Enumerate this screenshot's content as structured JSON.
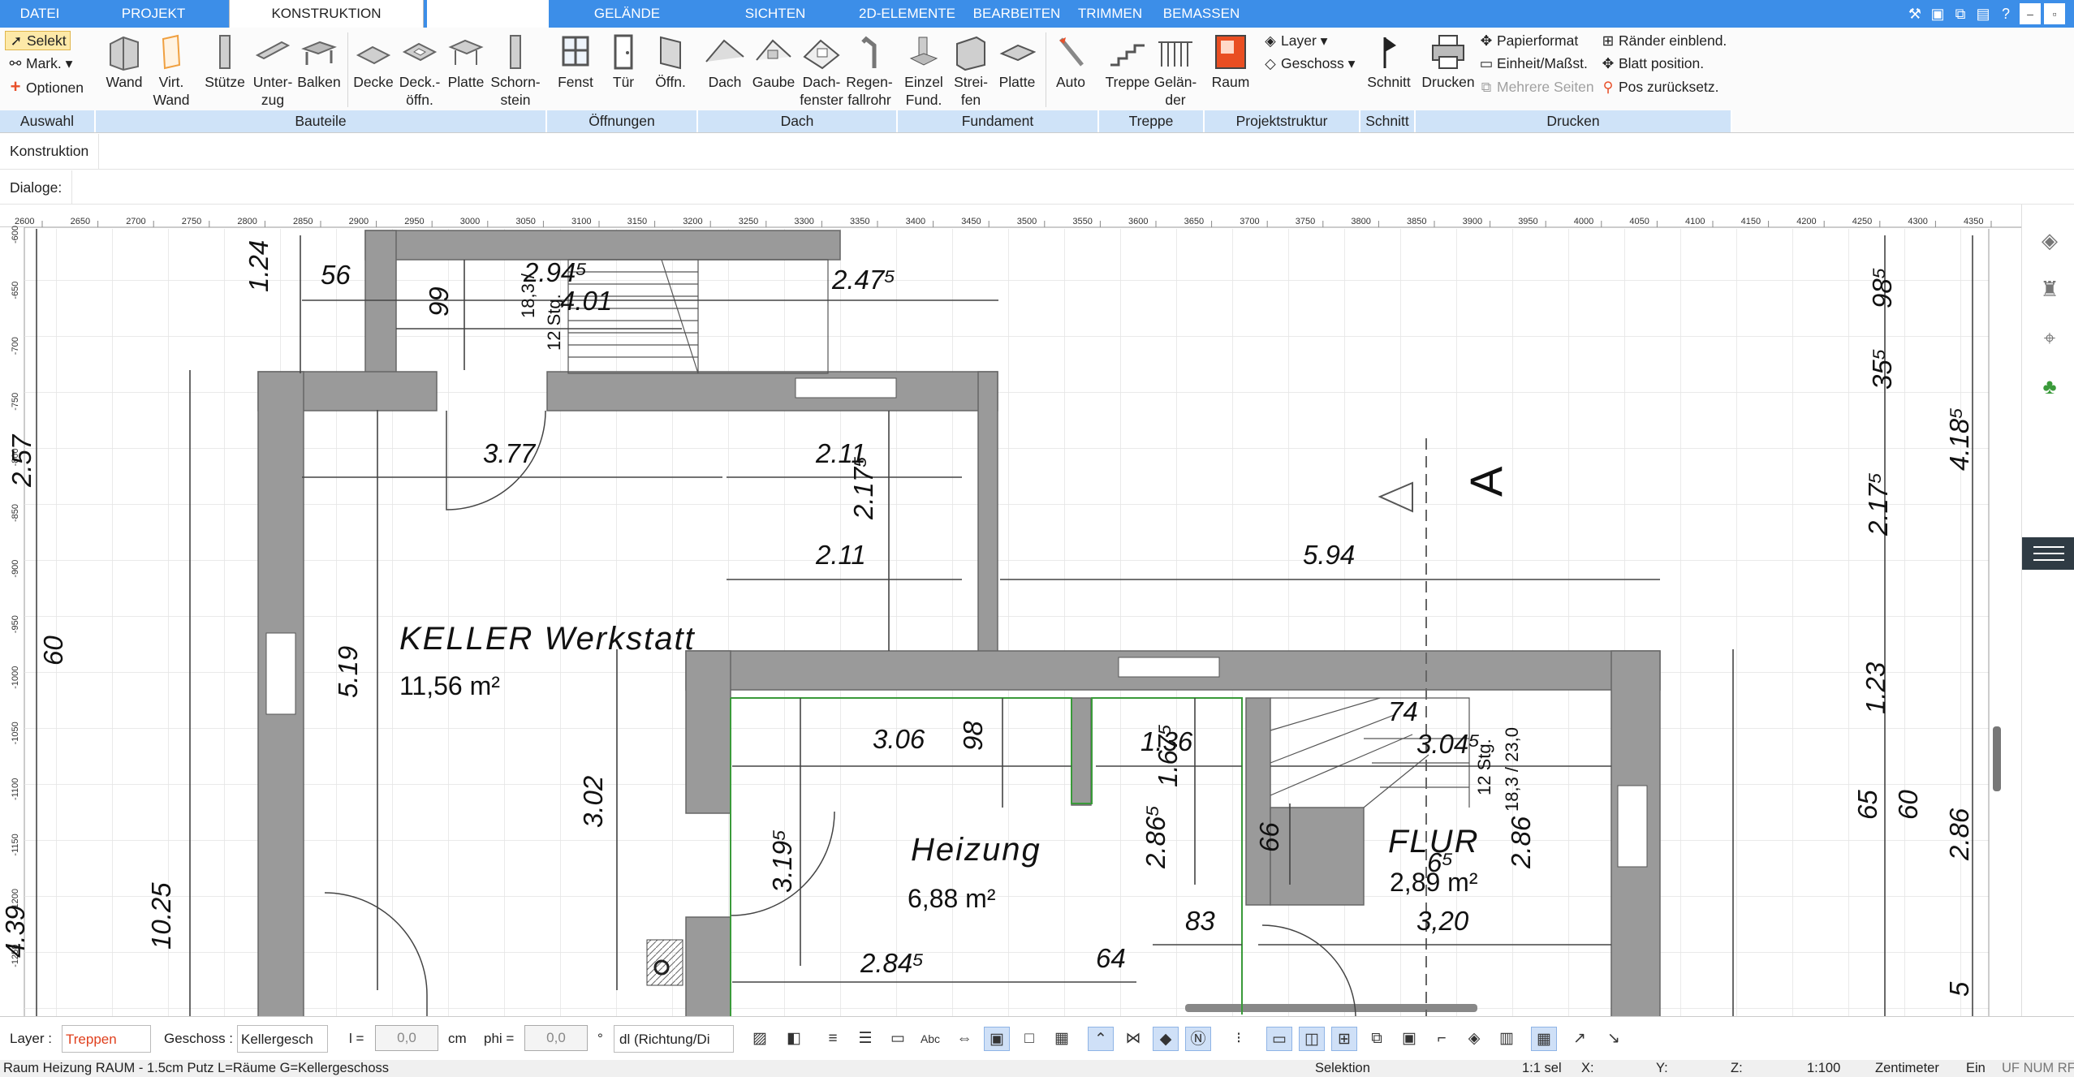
{
  "tabs": [
    {
      "label": "DATEI",
      "active": false
    },
    {
      "label": "PROJEKT",
      "active": false
    },
    {
      "label": "KONSTRUKTION",
      "active": true
    },
    {
      "label": "",
      "active": false
    },
    {
      "label": "GELÄNDE",
      "active": false
    },
    {
      "label": "SICHTEN",
      "active": false
    },
    {
      "label": "2D-ELEMENTE",
      "active": false
    },
    {
      "label": "BEARBEITEN",
      "active": false
    },
    {
      "label": "TRIMMEN",
      "active": false
    },
    {
      "label": "BEMASSEN",
      "active": false
    }
  ],
  "ribbon": {
    "auswahl": {
      "selekt": "Selekt",
      "mark": "Mark.",
      "optionen": "Optionen",
      "group": "Auswahl"
    },
    "bauteile": {
      "group": "Bauteile",
      "wand": "Wand",
      "virt_wand": "Virt.\nWand",
      "stuetze": "Stütze",
      "unterzug": "Unter-\nzug",
      "balken": "Balken",
      "decke": "Decke",
      "deckoeffn": "Deck.-\nöffn.",
      "platte": "Platte",
      "schornstein": "Schorn-\nstein"
    },
    "oeffnungen": {
      "group": "Öffnungen",
      "fenst": "Fenst",
      "tuer": "Tür",
      "oeffn": "Öffn."
    },
    "dach": {
      "group": "Dach",
      "dach": "Dach",
      "gaube": "Gaube",
      "dachfenster": "Dach-\nfenster",
      "regenfallrohr": "Regen-\nfallrohr"
    },
    "fundament": {
      "group": "Fundament",
      "einzel": "Einzel\nFund.",
      "streifen": "Strei-\nfen",
      "platte": "Platte",
      "auto": "Auto"
    },
    "treppe": {
      "group": "Treppe",
      "treppe": "Treppe",
      "gelaender": "Gelän-\nder"
    },
    "projektstruktur": {
      "group": "Projektstruktur",
      "raum": "Raum",
      "layer": "Layer",
      "geschoss": "Geschoss"
    },
    "schnitt": {
      "group": "Schnitt",
      "schnitt": "Schnitt"
    },
    "drucken": {
      "group": "Drucken",
      "drucken": "Drucken",
      "papierformat": "Papierformat",
      "einheit": "Einheit/Maßst.",
      "mehrere": "Mehrere Seiten",
      "raender": "Ränder einblend.",
      "blatt": "Blatt position.",
      "pos": "Pos zurücksetz."
    }
  },
  "context_row": {
    "label": "Konstruktion"
  },
  "dialog_row": {
    "label": "Dialoge:"
  },
  "ruler_top": [
    "2600",
    "2650",
    "2700",
    "2750",
    "2800",
    "2850",
    "2900",
    "2950",
    "3000",
    "3050",
    "3100",
    "3150",
    "3200",
    "3250",
    "3300",
    "3350",
    "3400",
    "3450",
    "3500",
    "3550",
    "3600",
    "3650",
    "3700",
    "3750",
    "3800",
    "3850",
    "3900",
    "3950",
    "4000",
    "4050",
    "4100",
    "4150",
    "4200",
    "4250",
    "4300",
    "4350"
  ],
  "ruler_left": [
    "-600",
    "-650",
    "-700",
    "-750",
    "-800",
    "-850",
    "-900",
    "-950",
    "-1000",
    "-1050",
    "-1100",
    "-1150",
    "-1200",
    "-1250"
  ],
  "plan": {
    "rooms": [
      {
        "name": "KELLER Werkstatt",
        "area": "11,56 m²"
      },
      {
        "name": "Heizung",
        "area": "6,88 m²"
      },
      {
        "name": "FLUR",
        "area": "2,89 m²"
      }
    ],
    "section_label": "A",
    "stair_notes": [
      "18,3 /",
      "12 Stg.",
      "12 Stg.",
      "18,3 / 23,0"
    ],
    "dimensions": [
      "56",
      "1.24",
      "2.94⁵",
      "4.01",
      "99",
      "2.47⁵",
      "3.77",
      "2.11",
      "2.11",
      "2.17⁵",
      "5.94",
      "5.19",
      "3.06",
      "98",
      "1.36",
      "1.67⁵",
      "3.02",
      "3.19⁵",
      "2.86⁵",
      "66",
      "2.84⁵",
      "64",
      "83",
      "3,20",
      "2.86",
      "74",
      "3.04⁵",
      "10.25",
      "2.57",
      "60",
      "4.39",
      "98⁵",
      "35⁵",
      "4.18⁵",
      "2.17⁵",
      "1.23",
      "65",
      "60",
      "2.86",
      "5",
      "6⁵"
    ]
  },
  "options_bar": {
    "layer_label": "Layer :",
    "layer_value": "Treppen",
    "geschoss_label": "Geschoss :",
    "geschoss_value": "Kellergesch",
    "l_label": "l =",
    "l_value": "0,0",
    "l_unit": "cm",
    "phi_label": "phi =",
    "phi_value": "0,0",
    "phi_unit": "°",
    "dl_value": "dl (Richtung/Di"
  },
  "status": {
    "left": "Raum Heizung RAUM - 1.5cm Putz L=Räume G=Kellergeschoss",
    "mode": "Selektion",
    "sel": "1:1 sel",
    "x": "X:",
    "y": "Y:",
    "z": "Z:",
    "scale": "1:100",
    "unit": "Zentimeter",
    "ein": "Ein",
    "flags": "UF NUM RF"
  },
  "colors": {
    "accent": "#3c8ee8",
    "wall": "#9a9a9a",
    "group_bg": "#cfe3f8"
  }
}
